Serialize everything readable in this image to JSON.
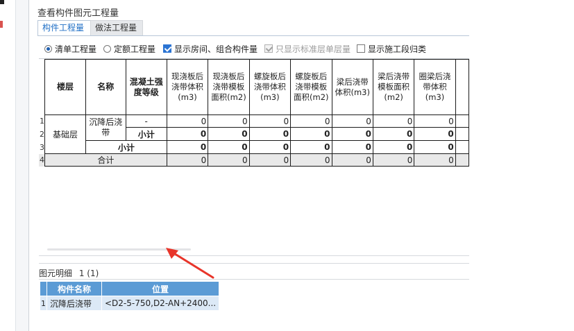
{
  "dialog": {
    "title": "查看构件图元工程量",
    "tabs": [
      {
        "label": "构件工程量",
        "active": true
      },
      {
        "label": "做法工程量",
        "active": false
      }
    ]
  },
  "options": {
    "radio_qingdan": {
      "label": "清单工程量",
      "checked": true
    },
    "radio_dinge": {
      "label": "定额工程量",
      "checked": false
    },
    "cb_show_rooms": {
      "label": "显示房间、组合构件量",
      "checked": true
    },
    "cb_standard_floor": {
      "label": "只显示标准层单层量",
      "checked": true,
      "disabled": true
    },
    "cb_construction_stage": {
      "label": "显示施工段归类",
      "checked": false
    }
  },
  "grid": {
    "headers": {
      "floor": "楼层",
      "name": "名称",
      "grade": "混凝土强度等级",
      "cols": [
        "现浇板后浇带体积(m3)",
        "现浇板后浇带模板面积(m2)",
        "螺旋板后浇带体积(m3)",
        "螺旋板后浇带模板面积(m2)",
        "梁后浇带体积(m3)",
        "梁后浇带模板面积(m2)",
        "圈梁后浇带体积(m3)"
      ]
    },
    "row_numbers": [
      "1",
      "2",
      "3",
      "4"
    ],
    "floor_value": "基础层",
    "name_value": "沉降后浇带",
    "grade_dash": "-",
    "subtotal": "小计",
    "total": "合计",
    "values": {
      "r1": [
        "0",
        "0",
        "0",
        "0",
        "0",
        "0",
        "0"
      ],
      "r2": [
        "0",
        "0",
        "0",
        "0",
        "0",
        "0",
        "0"
      ],
      "r3": [
        "0",
        "0",
        "0",
        "0",
        "0",
        "0",
        "0"
      ],
      "r4": [
        "0",
        "0",
        "0",
        "0",
        "0",
        "0",
        "0"
      ]
    }
  },
  "detail": {
    "title": "图元明细",
    "count": "1 (1)",
    "headers": {
      "name": "构件名称",
      "position": "位置"
    },
    "row_number": "1",
    "row": {
      "name": "沉降后浇带",
      "position": "<D2-5-750,D2-AN+2400..."
    }
  },
  "colors": {
    "accent": "#1f6fc6",
    "detail_header": "#5b9bd5",
    "detail_row": "#dce9f6",
    "arrow": "#e8352a"
  }
}
